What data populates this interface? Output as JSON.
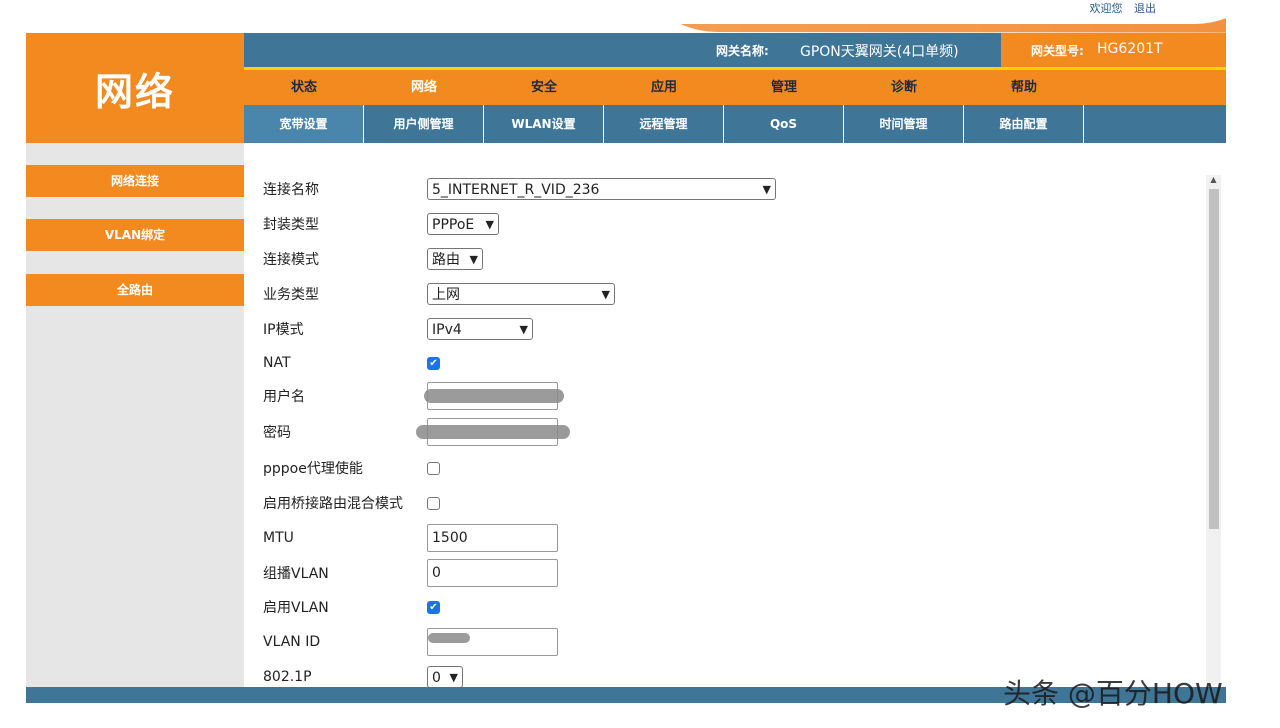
{
  "top_links": [
    "欢迎您",
    "退出"
  ],
  "logo_text": "网络",
  "header": {
    "gateway_name_label": "网关名称:",
    "gateway_name_value": "GPON天翼网关(4口单频)",
    "gateway_model_label": "网关型号:",
    "gateway_model_value": "HG6201T"
  },
  "main_nav": [
    "状态",
    "网络",
    "安全",
    "应用",
    "管理",
    "诊断",
    "帮助"
  ],
  "sub_nav": [
    "宽带设置",
    "用户侧管理",
    "WLAN设置",
    "远程管理",
    "QoS",
    "时间管理",
    "路由配置"
  ],
  "sidebar": [
    "网络连接",
    "VLAN绑定",
    "全路由"
  ],
  "form": {
    "connection_name": {
      "label": "连接名称",
      "value": "5_INTERNET_R_VID_236"
    },
    "encap_type": {
      "label": "封装类型",
      "value": "PPPoE"
    },
    "conn_mode": {
      "label": "连接模式",
      "value": "路由"
    },
    "service_type": {
      "label": "业务类型",
      "value": "上网"
    },
    "ip_mode": {
      "label": "IP模式",
      "value": "IPv4"
    },
    "nat": {
      "label": "NAT",
      "checked": true
    },
    "username": {
      "label": "用户名"
    },
    "password": {
      "label": "密码"
    },
    "pppoe_proxy": {
      "label": "pppoe代理使能",
      "checked": false
    },
    "bridge_mix": {
      "label": "启用桥接路由混合模式",
      "checked": false
    },
    "mtu": {
      "label": "MTU",
      "value": "1500"
    },
    "multicast_vlan": {
      "label": "组播VLAN",
      "value": "0"
    },
    "enable_vlan": {
      "label": "启用VLAN",
      "checked": true
    },
    "vlan_id": {
      "label": "VLAN ID"
    },
    "dot1p": {
      "label": "802.1P",
      "value": "0"
    }
  },
  "watermark": "头条 @百分HOW",
  "colors": {
    "orange": "#f28a20",
    "blue": "#3f7698",
    "yellow": "#ffd200"
  }
}
